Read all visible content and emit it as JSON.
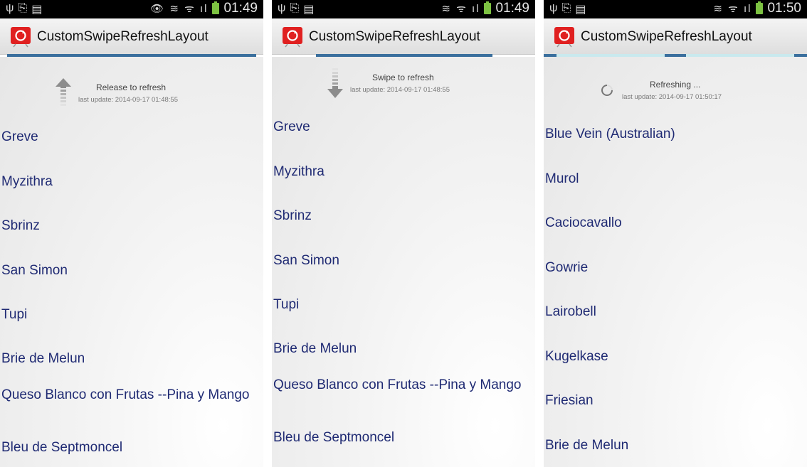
{
  "status_bar": {
    "times": [
      "01:49",
      "01:49",
      "01:50"
    ]
  },
  "app": {
    "title": "CustomSwipeRefreshLayout",
    "accent_color": "#3a6f9d",
    "list_text_color": "#1f2a73",
    "icon_color": "#e02020"
  },
  "screens": [
    {
      "state": "release",
      "refresh_status": "Release to refresh",
      "last_update": "last update: 2014-09-17 01:48:55",
      "indicator_icon": "arrow-up-icon",
      "items": [
        "Greve",
        "Myzithra",
        "Sbrinz",
        "San Simon",
        "Tupi",
        "Brie de Melun",
        "Queso Blanco con Frutas --Pina y Mango",
        "Bleu de Septmoncel"
      ]
    },
    {
      "state": "swipe",
      "refresh_status": "Swipe to refresh",
      "last_update": "last update: 2014-09-17 01:48:55",
      "indicator_icon": "arrow-down-icon",
      "items": [
        "Greve",
        "Myzithra",
        "Sbrinz",
        "San Simon",
        "Tupi",
        "Brie de Melun",
        "Queso Blanco con Frutas --Pina y Mango",
        "Bleu de Septmoncel"
      ]
    },
    {
      "state": "refreshing",
      "refresh_status": "Refreshing ...",
      "last_update": "last update: 2014-09-17 01:50:17",
      "indicator_icon": "spinner-icon",
      "items": [
        "Blue Vein (Australian)",
        "Murol",
        "Caciocavallo",
        "Gowrie",
        "Lairobell",
        "Kugelkase",
        "Friesian",
        "Brie de Melun"
      ]
    }
  ]
}
